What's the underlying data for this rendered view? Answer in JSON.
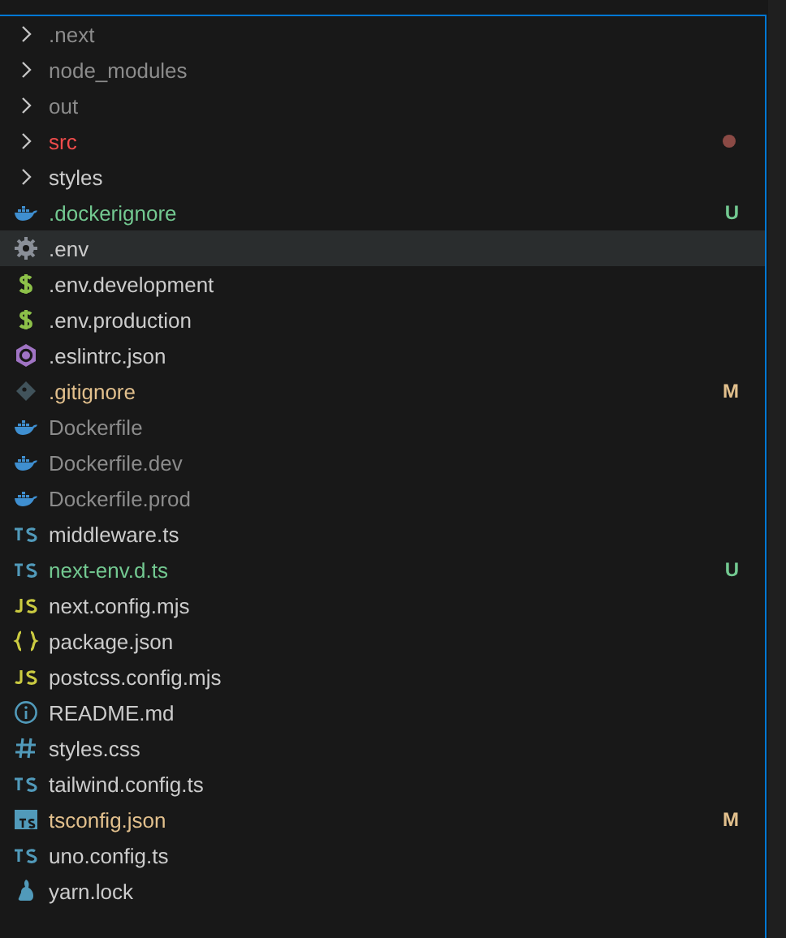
{
  "explorer": {
    "items": [
      {
        "kind": "folder",
        "name": ".next",
        "color": "#8c8c8c",
        "selected": false
      },
      {
        "kind": "folder",
        "name": "node_modules",
        "color": "#8c8c8c",
        "selected": false
      },
      {
        "kind": "folder",
        "name": "out",
        "color": "#8c8c8c",
        "selected": false
      },
      {
        "kind": "folder",
        "name": "src",
        "color": "#f14c4c",
        "dot": true,
        "selected": false
      },
      {
        "kind": "folder",
        "name": "styles",
        "color": "#cccccc",
        "selected": false
      },
      {
        "kind": "docker",
        "name": ".dockerignore",
        "color": "#73c991",
        "badge": "U",
        "selected": false
      },
      {
        "kind": "gear",
        "name": ".env",
        "color": "#cccccc",
        "selected": true
      },
      {
        "kind": "dollar",
        "name": ".env.development",
        "color": "#cccccc",
        "selected": false
      },
      {
        "kind": "dollar",
        "name": ".env.production",
        "color": "#cccccc",
        "selected": false
      },
      {
        "kind": "hexagon",
        "name": ".eslintrc.json",
        "color": "#cccccc",
        "selected": false
      },
      {
        "kind": "diamond",
        "name": ".gitignore",
        "color": "#e2c08d",
        "badge": "M",
        "selected": false
      },
      {
        "kind": "docker",
        "name": "Dockerfile",
        "color": "#8c8c8c",
        "selected": false
      },
      {
        "kind": "docker",
        "name": "Dockerfile.dev",
        "color": "#8c8c8c",
        "selected": false
      },
      {
        "kind": "docker",
        "name": "Dockerfile.prod",
        "color": "#8c8c8c",
        "selected": false
      },
      {
        "kind": "ts",
        "name": "middleware.ts",
        "color": "#cccccc",
        "selected": false
      },
      {
        "kind": "ts",
        "name": "next-env.d.ts",
        "color": "#73c991",
        "badge": "U",
        "selected": false
      },
      {
        "kind": "js",
        "name": "next.config.mjs",
        "color": "#cccccc",
        "selected": false
      },
      {
        "kind": "braces",
        "name": "package.json",
        "color": "#cccccc",
        "selected": false
      },
      {
        "kind": "js",
        "name": "postcss.config.mjs",
        "color": "#cccccc",
        "selected": false
      },
      {
        "kind": "info",
        "name": "README.md",
        "color": "#cccccc",
        "selected": false
      },
      {
        "kind": "hash",
        "name": "styles.css",
        "color": "#cccccc",
        "selected": false
      },
      {
        "kind": "ts",
        "name": "tailwind.config.ts",
        "color": "#cccccc",
        "selected": false
      },
      {
        "kind": "tsbox",
        "name": "tsconfig.json",
        "color": "#e2c08d",
        "badge": "M",
        "selected": false
      },
      {
        "kind": "ts",
        "name": "uno.config.ts",
        "color": "#cccccc",
        "selected": false
      },
      {
        "kind": "yarn",
        "name": "yarn.lock",
        "color": "#cccccc",
        "selected": false
      }
    ]
  }
}
